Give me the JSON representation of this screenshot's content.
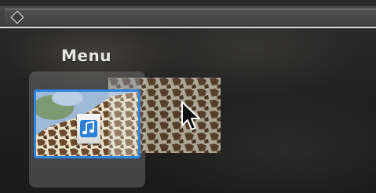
{
  "menu": {
    "title": "Menu"
  },
  "icons": {
    "top_left": "diamond-icon",
    "badge": "music-note-icon",
    "pointer": "arrow-cursor-icon"
  },
  "colors": {
    "selection_border": "#2d84e0",
    "title_text": "#e6e6e6",
    "top_bar_line": "#d9d9d9"
  }
}
